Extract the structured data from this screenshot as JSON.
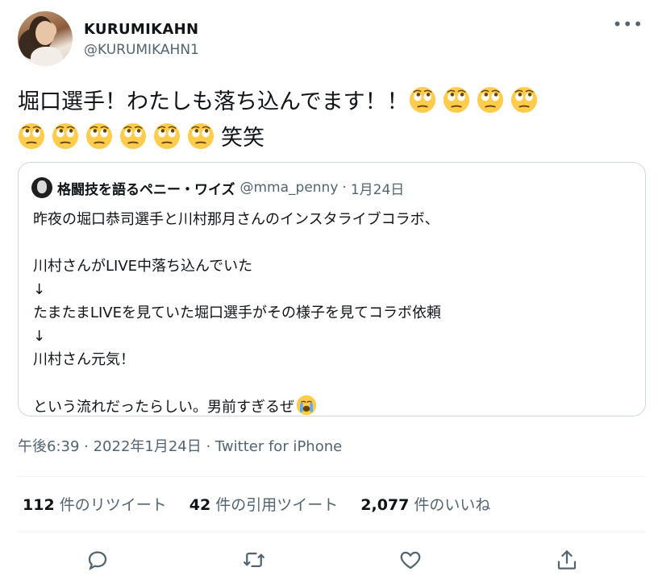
{
  "user": {
    "display_name": "KURUMIKAHN",
    "handle": "@KURUMIKAHN1"
  },
  "tweet": {
    "text_part1": "堀口選手！わたしも落ち込んでます！！",
    "text_part2": "笑笑",
    "emoji_name": "face-with-rolling-eyes",
    "emoji_count_line1": 4,
    "emoji_count_line2": 6
  },
  "quote": {
    "name": "格闘技を語るペニー・ワイズ",
    "handle": "@mma_penny",
    "dot": "·",
    "date": "1月24日",
    "lines": [
      "昨夜の堀口恭司選手と川村那月さんのインスタライブコラボ、",
      "",
      "川村さんがLIVE中落ち込んでいた",
      "↓",
      "たまたまLIVEを見ていた堀口選手がその様子を見てコラボ依頼",
      "↓",
      "川村さん元気！",
      "",
      "という流れだったらしい。男前すぎるぜ"
    ],
    "end_emoji": "loudly-crying-face"
  },
  "meta": "午後6:39 · 2022年1月24日 · Twitter for iPhone",
  "stats": {
    "retweets_count": "112",
    "retweets_label": "件のリツイート",
    "quotes_count": "42",
    "quotes_label": "件の引用ツイート",
    "likes_count": "2,077",
    "likes_label": "件のいいね"
  },
  "icons": {
    "more": "more-icon",
    "reply": "reply-icon",
    "retweet": "retweet-icon",
    "like": "heart-icon",
    "share": "share-icon"
  },
  "colors": {
    "text": "#0f1419",
    "secondary": "#536471",
    "border": "#cfd9de"
  }
}
